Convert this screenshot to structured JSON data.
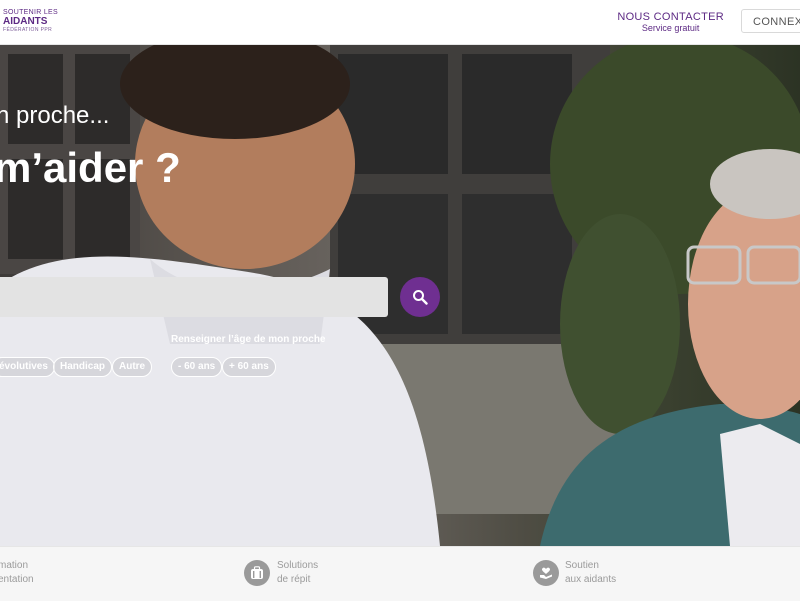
{
  "header": {
    "logo": {
      "line1": "SOUTENIR LES",
      "line2": "AIDANTS",
      "line3": "FÉDÉRATION PPR"
    },
    "contact": {
      "title": "NOUS CONTACTER",
      "subtitle": "Service gratuit"
    },
    "login_label": "CONNEXION"
  },
  "hero": {
    "line1": "n proche...",
    "line2": "m’aider ?",
    "age_label": "Renseigner l’âge de mon proche",
    "chips_situation": [
      "évolutives",
      "Handicap",
      "Autre"
    ],
    "chips_age": [
      "- 60 ans",
      "+ 60 ans"
    ]
  },
  "features": [
    {
      "line1": "mation",
      "line2": "entation"
    },
    {
      "icon": "suitcase-icon",
      "line1": "Solutions",
      "line2": "de répit"
    },
    {
      "icon": "heart-hand-icon",
      "line1": "Soutien",
      "line2": "aux aidants"
    }
  ],
  "colors": {
    "brand": "#6f2f91",
    "brand_text": "#5d2a84"
  }
}
